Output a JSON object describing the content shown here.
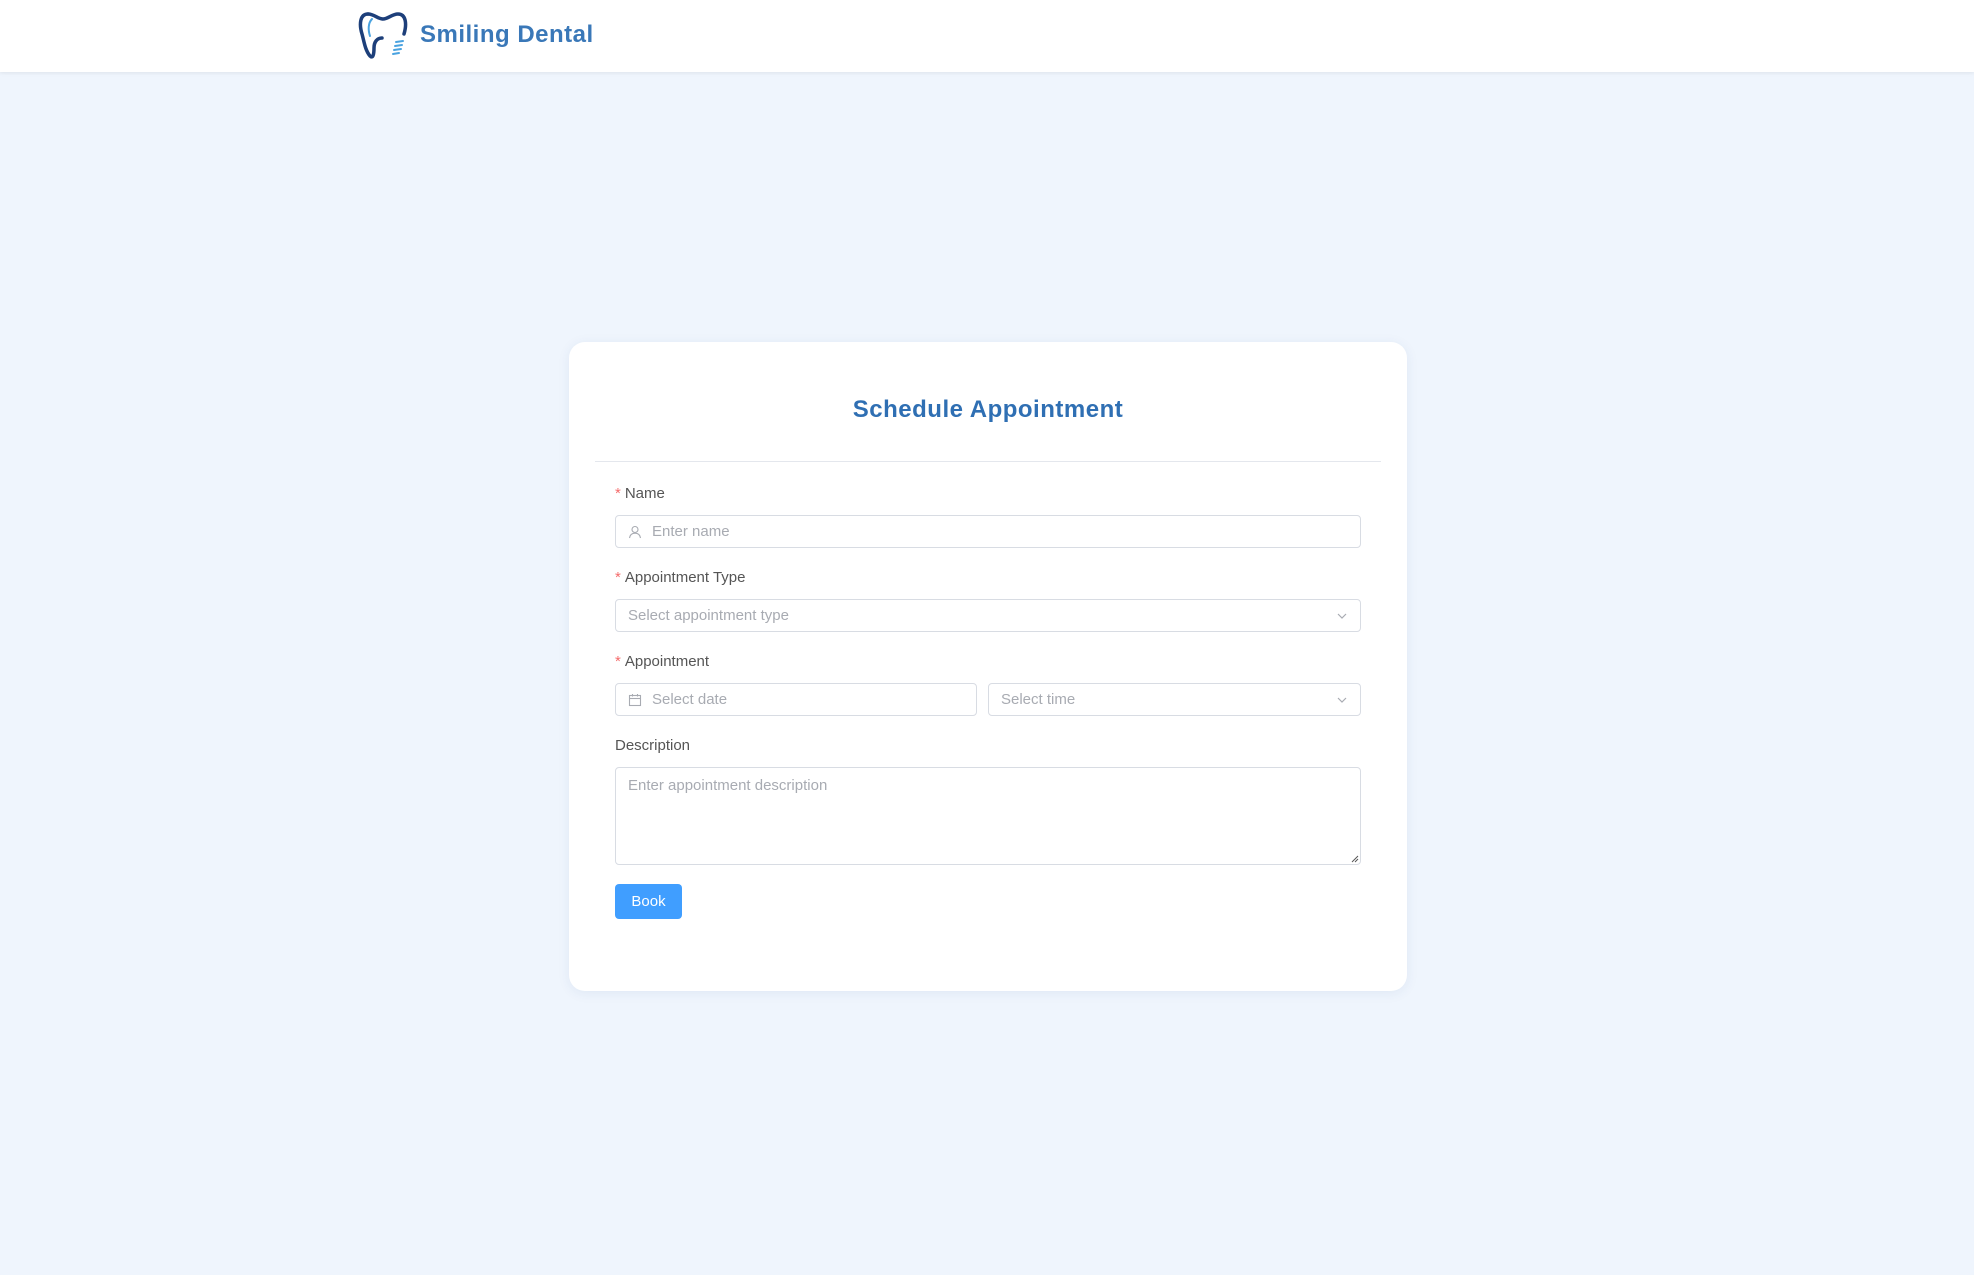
{
  "header": {
    "brand_name": "Smiling Dental",
    "logo_icon": "tooth-implant-icon",
    "brand_color": "#3a78b8"
  },
  "form": {
    "title": "Schedule Appointment",
    "required_marker": "*",
    "name": {
      "label": "Name",
      "placeholder": "Enter name",
      "icon": "user-icon",
      "value": ""
    },
    "appointment_type": {
      "label": "Appointment Type",
      "placeholder": "Select appointment type",
      "icon": "chevron-down-icon",
      "selected": ""
    },
    "appointment": {
      "label": "Appointment",
      "date_placeholder": "Select date",
      "date_icon": "calendar-icon",
      "time_placeholder": "Select time",
      "time_icon": "chevron-down-icon"
    },
    "description": {
      "label": "Description",
      "placeholder": "Enter appointment description",
      "value": ""
    },
    "submit_label": "Book"
  },
  "colors": {
    "page_background": "#eff5fd",
    "primary": "#409eff",
    "title": "#2f6fb3",
    "required": "#f56c6c"
  }
}
